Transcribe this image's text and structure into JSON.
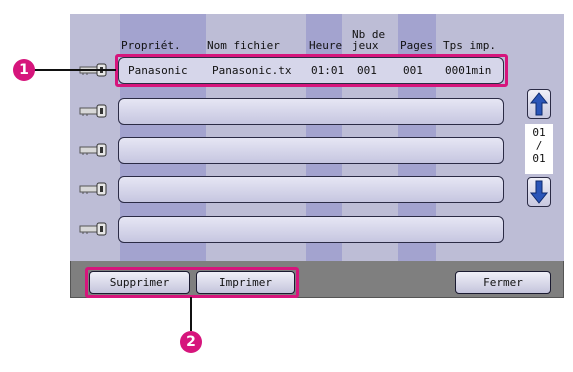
{
  "columns": {
    "owner": "Propriét.",
    "filename": "Nom fichier",
    "time": "Heure",
    "sets_line1": "Nb de",
    "sets_line2": "jeux",
    "pages": "Pages",
    "print_time": "Tps imp."
  },
  "jobs": [
    {
      "owner": "Panasonic",
      "filename": "Panasonic.tx",
      "time": "01:01",
      "sets": "001",
      "pages": "001",
      "print_time": "0001min"
    }
  ],
  "pager": {
    "current": "01",
    "separator": "/",
    "total": "01"
  },
  "buttons": {
    "delete": "Supprimer",
    "print": "Imprimer",
    "close": "Fermer"
  },
  "callouts": {
    "row": "1",
    "buttons": "2"
  },
  "colors": {
    "accent": "#d6157c",
    "screen": "#bdbdd6",
    "frame": "#7f7f7f"
  },
  "icons": {
    "row_icon": "key-icon",
    "scroll_up": "arrow-up-icon",
    "scroll_down": "arrow-down-icon"
  }
}
